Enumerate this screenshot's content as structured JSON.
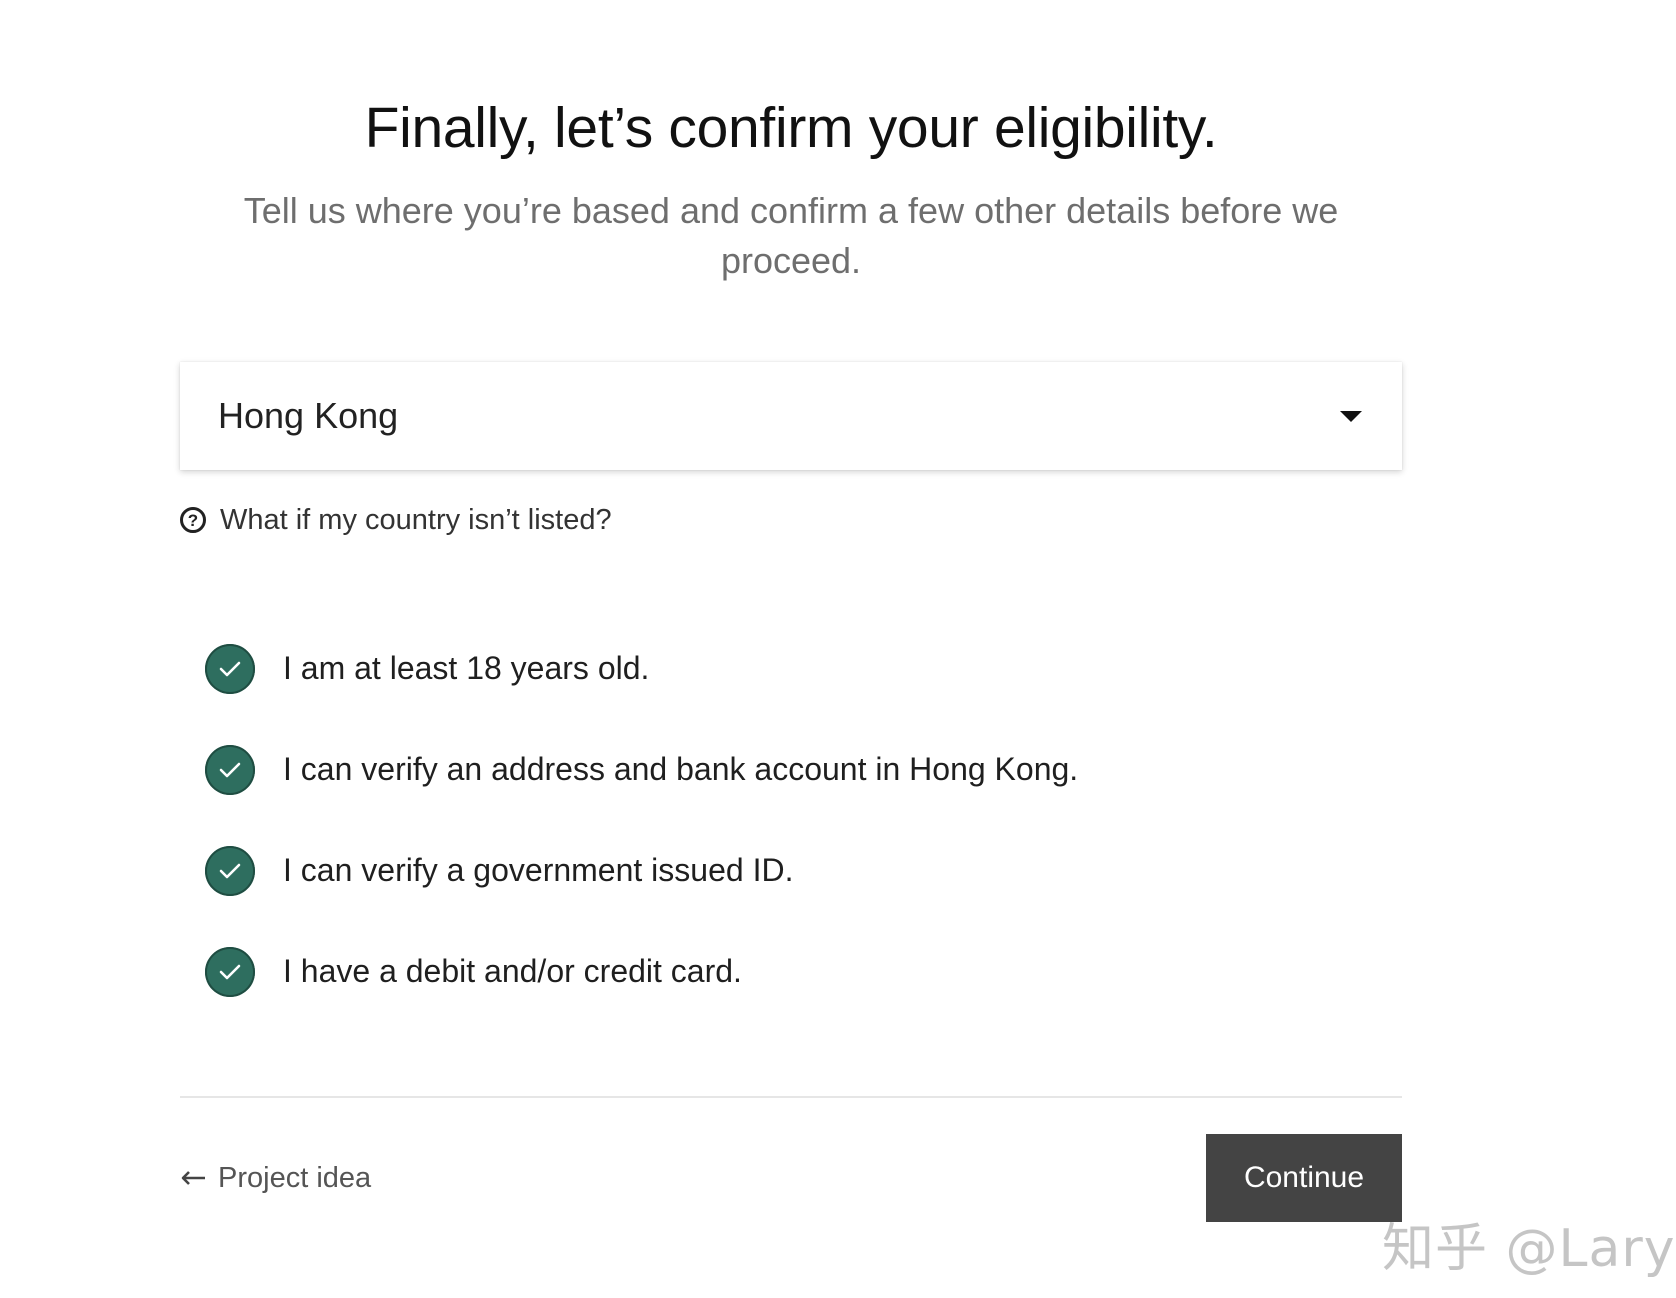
{
  "header": {
    "title": "Finally, let’s confirm your eligibility.",
    "subtitle": "Tell us where you’re based and confirm a few other details before we proceed."
  },
  "country_select": {
    "selected_value": "Hong Kong",
    "caret_icon": "caret-down-icon"
  },
  "help_link": {
    "icon": "question-circle-icon",
    "label": "What if my country isn’t listed?"
  },
  "checklist": {
    "items": [
      {
        "label": "I am at least 18 years old.",
        "checked": true
      },
      {
        "label": "I can verify an address and bank account in Hong Kong.",
        "checked": true
      },
      {
        "label": "I can verify a government issued ID.",
        "checked": true
      },
      {
        "label": "I have a debit and/or credit card.",
        "checked": true
      }
    ],
    "check_color": "#2e6e5f"
  },
  "footer": {
    "back_label": "Project idea",
    "back_icon": "arrow-left-icon",
    "continue_label": "Continue",
    "continue_bg": "#444444"
  },
  "watermark": {
    "text": "知乎 @Lary"
  }
}
